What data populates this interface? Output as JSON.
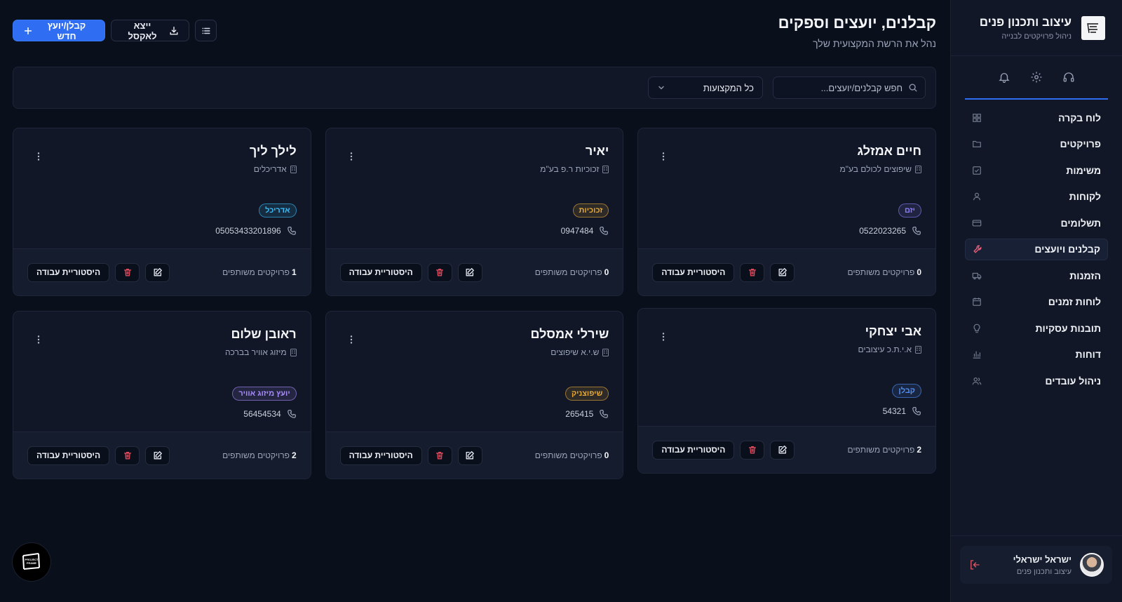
{
  "brand": {
    "title": "עיצוב ותכנון פנים",
    "subtitle": "ניהול פרויקטים לבנייה"
  },
  "top_icons": [
    "headset-icon",
    "gear-icon",
    "bell-icon"
  ],
  "nav": [
    {
      "label": "לוח בקרה",
      "icon": "dashboard-icon"
    },
    {
      "label": "פרויקטים",
      "icon": "folder-icon"
    },
    {
      "label": "משימות",
      "icon": "checkbox-icon"
    },
    {
      "label": "לקוחות",
      "icon": "user-icon"
    },
    {
      "label": "תשלומים",
      "icon": "credit-card-icon"
    },
    {
      "label": "קבלנים ויועצים",
      "icon": "wrench-icon",
      "active": true
    },
    {
      "label": "הזמנות",
      "icon": "truck-icon"
    },
    {
      "label": "לוחות זמנים",
      "icon": "calendar-icon"
    },
    {
      "label": "תובנות עסקיות",
      "icon": "lightbulb-icon"
    },
    {
      "label": "דוחות",
      "icon": "bar-chart-icon"
    },
    {
      "label": "ניהול עובדים",
      "icon": "users-icon"
    }
  ],
  "user": {
    "name": "ישראל ישראלי",
    "role": "עיצוב ותכנון פנים"
  },
  "header": {
    "title": "קבלנים, יועצים וספקים",
    "subtitle": "נהל את הרשת המקצועית שלך",
    "new_button": "קבלן/יועץ חדש",
    "export_button": "ייצא לאקסל"
  },
  "filters": {
    "search_placeholder": "חפש קבלנים/יועצים...",
    "profession_select": "כל המקצועות"
  },
  "colors": {
    "accent": "#2f6ef2",
    "danger": "#e04a5c",
    "background": "#0a0f1c",
    "panel": "#111726"
  },
  "card_labels": {
    "shared_projects": "פרויקטים משותפים",
    "history_button": "היסטוריית עבודה"
  },
  "contractors": [
    {
      "name": "חיים אמזלג",
      "company": "שיפוצים לכולם בע\"מ",
      "badge": "יזם",
      "badge_color": "#8b7cf6",
      "phone": "0522023265",
      "shared_count": "0"
    },
    {
      "name": "יאיר",
      "company": "זכוכיות ר.פ בע\"מ",
      "badge": "זכוכיות",
      "badge_color": "#e5a93a",
      "phone": "0947484",
      "shared_count": "0"
    },
    {
      "name": "לילך ליך",
      "company": "אדריכלים",
      "badge": "אדריכל",
      "badge_color": "#38bdf8",
      "phone": "05053433201896",
      "shared_count": "1"
    },
    {
      "name": "אבי יצחקי",
      "company": "א.י.ת.כ עיצובים",
      "badge": "קבלן",
      "badge_color": "#4f8ff7",
      "phone": "54321",
      "shared_count": "2"
    },
    {
      "name": "שירלי אמסלם",
      "company": "ש.י.א שיפוצים",
      "badge": "שיפוצניק",
      "badge_color": "#e5a93a",
      "phone": "265415",
      "shared_count": "0"
    },
    {
      "name": "ראובן שלום",
      "company": "מיזוג אוויר בברכה",
      "badge": "יועץ מיזוג אוויר",
      "badge_color": "#a78bfa",
      "phone": "56454534",
      "shared_count": "2"
    }
  ],
  "floating_logo": {
    "line1": "PROJECT",
    "line2": "FRAME"
  }
}
